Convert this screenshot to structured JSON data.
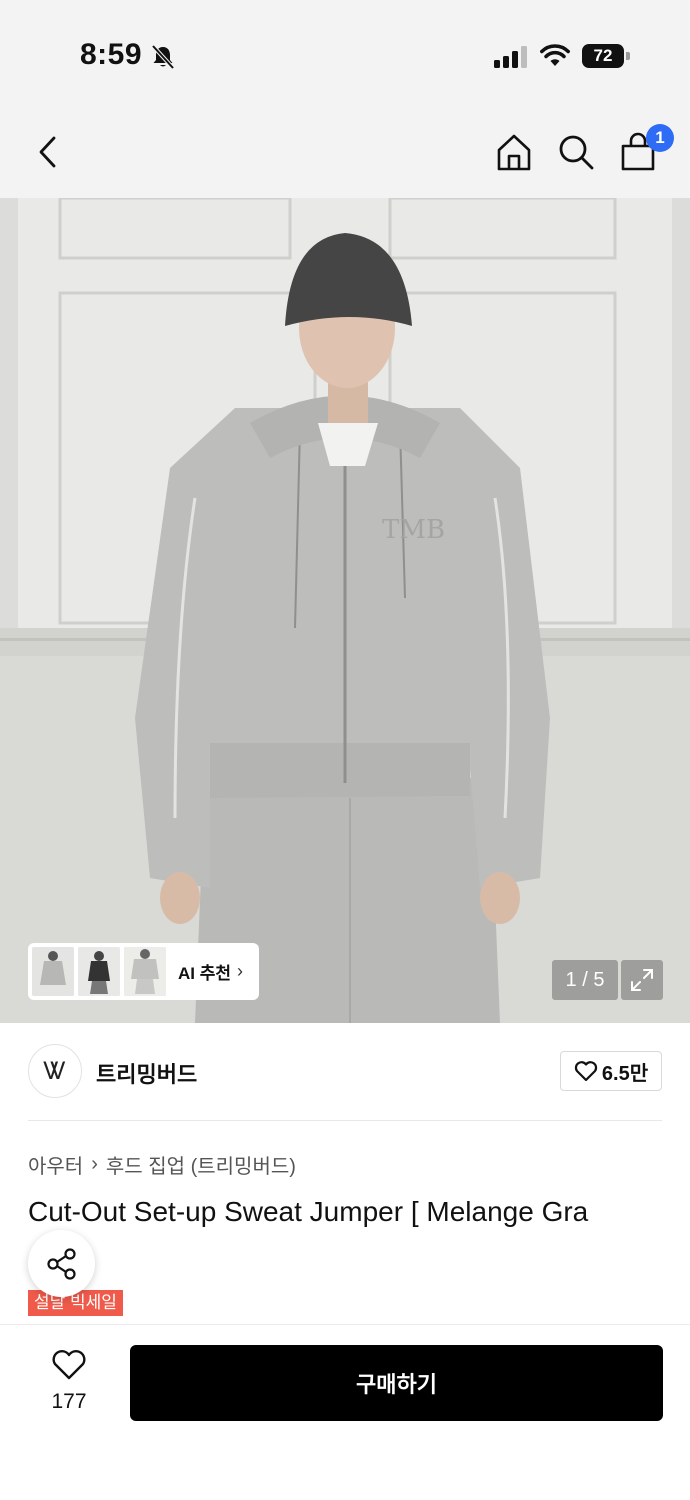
{
  "status_bar": {
    "time": "8:59",
    "battery": "72"
  },
  "nav": {
    "cart_count": "1"
  },
  "hero": {
    "ai_label": "AI 추천",
    "pager": "1 / 5"
  },
  "brand": {
    "logo_text": "Ꮤ",
    "name": "트리밍버드",
    "favorite_count": "6.5만"
  },
  "breadcrumb": {
    "category": "아우터",
    "subcategory": "후드 집업 (트리밍버드)"
  },
  "product": {
    "title": "Cut-Out Set-up Sweat Jumper [ Melange Gra",
    "sale_badge": "설날 빅세일"
  },
  "bottom": {
    "like_count": "177",
    "buy_label": "구매하기"
  },
  "colors": {
    "accent_blue": "#2f6cf6",
    "sale_red": "#ef5a4a",
    "buy_black": "#000000"
  }
}
